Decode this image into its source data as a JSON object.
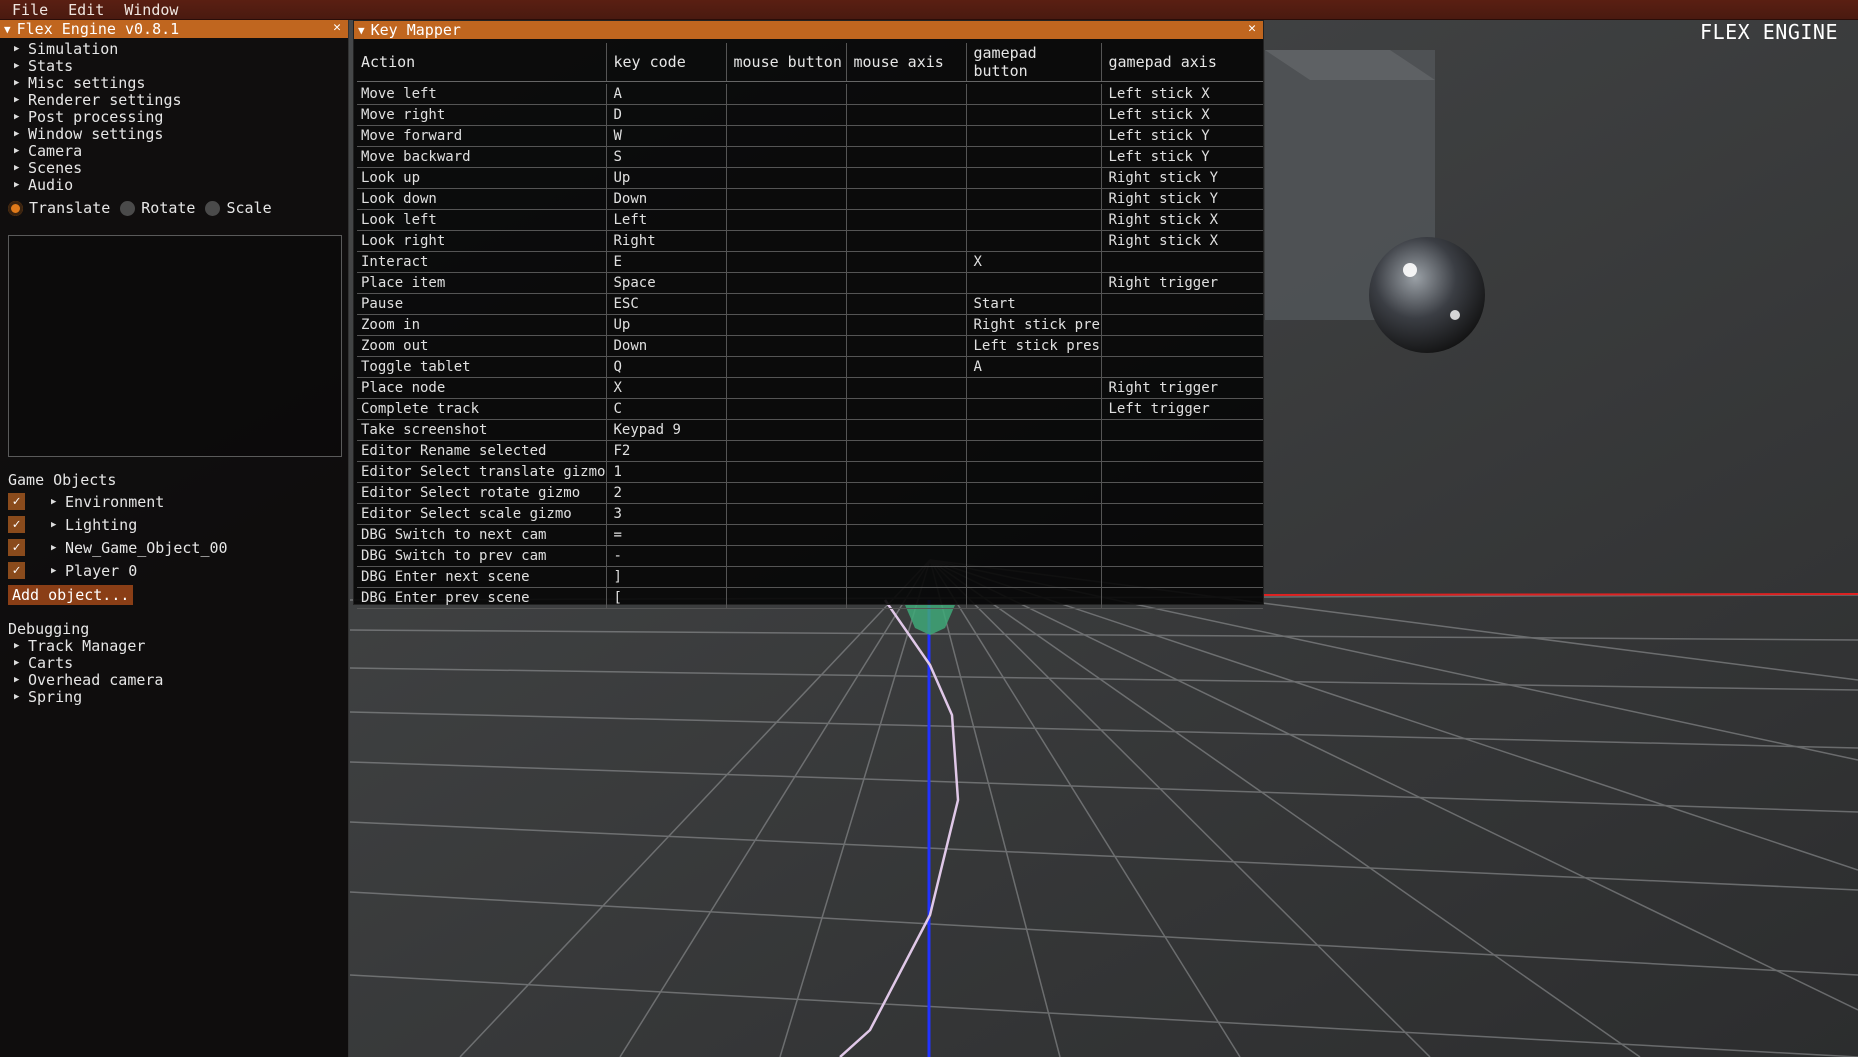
{
  "menubar": {
    "items": [
      "File",
      "Edit",
      "Window"
    ]
  },
  "brand": "FLEX ENGINE",
  "engine_panel": {
    "title": "Flex Engine v0.8.1",
    "sections": [
      "Simulation",
      "Stats",
      "Misc settings",
      "Renderer settings",
      "Post processing",
      "Window settings",
      "Camera",
      "Scenes",
      "Audio"
    ],
    "transform_modes": [
      {
        "label": "Translate",
        "selected": true
      },
      {
        "label": "Rotate",
        "selected": false
      },
      {
        "label": "Scale",
        "selected": false
      }
    ],
    "game_objects_label": "Game Objects",
    "game_objects": [
      "Environment",
      "Lighting",
      "New_Game_Object_00",
      "Player 0"
    ],
    "add_object_label": "Add object...",
    "debugging_label": "Debugging",
    "debugging_items": [
      "Track Manager",
      "Carts",
      "Overhead camera",
      "Spring"
    ]
  },
  "key_mapper": {
    "title": "Key Mapper",
    "columns": [
      "Action",
      "key code",
      "mouse button",
      "mouse axis",
      "gamepad button",
      "gamepad axis"
    ],
    "rows": [
      [
        "Move left",
        "A",
        "",
        "",
        "",
        "Left stick X"
      ],
      [
        "Move right",
        "D",
        "",
        "",
        "",
        "Left stick X"
      ],
      [
        "Move forward",
        "W",
        "",
        "",
        "",
        "Left stick Y"
      ],
      [
        "Move backward",
        "S",
        "",
        "",
        "",
        "Left stick Y"
      ],
      [
        "Look up",
        "Up",
        "",
        "",
        "",
        "Right stick Y"
      ],
      [
        "Look down",
        "Down",
        "",
        "",
        "",
        "Right stick Y"
      ],
      [
        "Look left",
        "Left",
        "",
        "",
        "",
        "Right stick X"
      ],
      [
        "Look right",
        "Right",
        "",
        "",
        "",
        "Right stick X"
      ],
      [
        "Interact",
        "E",
        "",
        "",
        "X",
        ""
      ],
      [
        "Place item",
        "Space",
        "",
        "",
        "",
        "Right trigger"
      ],
      [
        "Pause",
        "ESC",
        "",
        "",
        "Start",
        ""
      ],
      [
        "Zoom in",
        "Up",
        "",
        "",
        "Right stick pres",
        ""
      ],
      [
        "Zoom out",
        "Down",
        "",
        "",
        "Left stick press",
        ""
      ],
      [
        "Toggle tablet",
        "Q",
        "",
        "",
        "A",
        ""
      ],
      [
        "Place node",
        "X",
        "",
        "",
        "",
        "Right trigger"
      ],
      [
        "Complete track",
        "C",
        "",
        "",
        "",
        "Left trigger"
      ],
      [
        "Take screenshot",
        "Keypad 9",
        "",
        "",
        "",
        ""
      ],
      [
        "Editor Rename selected",
        "F2",
        "",
        "",
        "",
        ""
      ],
      [
        "Editor Select translate gizmo",
        "1",
        "",
        "",
        "",
        ""
      ],
      [
        "Editor Select rotate gizmo",
        "2",
        "",
        "",
        "",
        ""
      ],
      [
        "Editor Select scale gizmo",
        "3",
        "",
        "",
        "",
        ""
      ],
      [
        "DBG Switch to next cam",
        "=",
        "",
        "",
        "",
        ""
      ],
      [
        "DBG Switch to prev cam",
        "-",
        "",
        "",
        "",
        ""
      ],
      [
        "DBG Enter next scene",
        "]",
        "",
        "",
        "",
        ""
      ],
      [
        "DBG Enter prev scene",
        "[",
        "",
        "",
        "",
        ""
      ]
    ]
  },
  "colors": {
    "accent": "#c0661f",
    "menubar": "#4f1c11"
  }
}
